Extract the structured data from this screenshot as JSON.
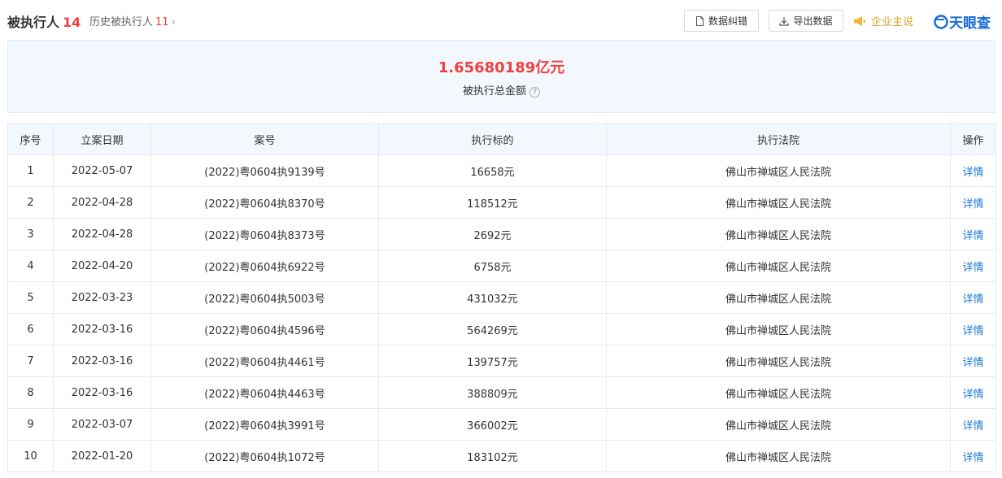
{
  "header": {
    "title": "被执行人",
    "title_count": "14",
    "history_label": "历史被执行人",
    "history_count": "11",
    "history_chevron": "›",
    "correct_button": "数据纠错",
    "export_button": "导出数据",
    "spokesperson": "企业主说",
    "brand": "天眼查"
  },
  "summary": {
    "amount": "1.65680189亿元",
    "label": "被执行总金额",
    "help": "?"
  },
  "table": {
    "columns": [
      "序号",
      "立案日期",
      "案号",
      "执行标的",
      "执行法院",
      "操作"
    ],
    "rows": [
      {
        "no": "1",
        "date": "2022-05-07",
        "case": "(2022)粤0604执9139号",
        "amount": "16658元",
        "court": "佛山市禅城区人民法院",
        "action": "详情"
      },
      {
        "no": "2",
        "date": "2022-04-28",
        "case": "(2022)粤0604执8370号",
        "amount": "118512元",
        "court": "佛山市禅城区人民法院",
        "action": "详情"
      },
      {
        "no": "3",
        "date": "2022-04-28",
        "case": "(2022)粤0604执8373号",
        "amount": "2692元",
        "court": "佛山市禅城区人民法院",
        "action": "详情"
      },
      {
        "no": "4",
        "date": "2022-04-20",
        "case": "(2022)粤0604执6922号",
        "amount": "6758元",
        "court": "佛山市禅城区人民法院",
        "action": "详情"
      },
      {
        "no": "5",
        "date": "2022-03-23",
        "case": "(2022)粤0604执5003号",
        "amount": "431032元",
        "court": "佛山市禅城区人民法院",
        "action": "详情"
      },
      {
        "no": "6",
        "date": "2022-03-16",
        "case": "(2022)粤0604执4596号",
        "amount": "564269元",
        "court": "佛山市禅城区人民法院",
        "action": "详情"
      },
      {
        "no": "7",
        "date": "2022-03-16",
        "case": "(2022)粤0604执4461号",
        "amount": "139757元",
        "court": "佛山市禅城区人民法院",
        "action": "详情"
      },
      {
        "no": "8",
        "date": "2022-03-16",
        "case": "(2022)粤0604执4463号",
        "amount": "388809元",
        "court": "佛山市禅城区人民法院",
        "action": "详情"
      },
      {
        "no": "9",
        "date": "2022-03-07",
        "case": "(2022)粤0604执3991号",
        "amount": "366002元",
        "court": "佛山市禅城区人民法院",
        "action": "详情"
      },
      {
        "no": "10",
        "date": "2022-01-20",
        "case": "(2022)粤0604执1072号",
        "amount": "183102元",
        "court": "佛山市禅城区人民法院",
        "action": "详情"
      }
    ]
  },
  "icons": {
    "correct": "document-icon",
    "export": "download-icon",
    "spokesperson": "megaphone-icon",
    "brand": "tianyancha-logo-icon",
    "help": "question-circle-icon"
  },
  "colors": {
    "accent_red": "#f04040",
    "link_blue": "#1a7ad6",
    "brand_blue": "#1a6bd6",
    "spokes_gold": "#d9a32b",
    "header_bg": "#f2f8fd"
  }
}
